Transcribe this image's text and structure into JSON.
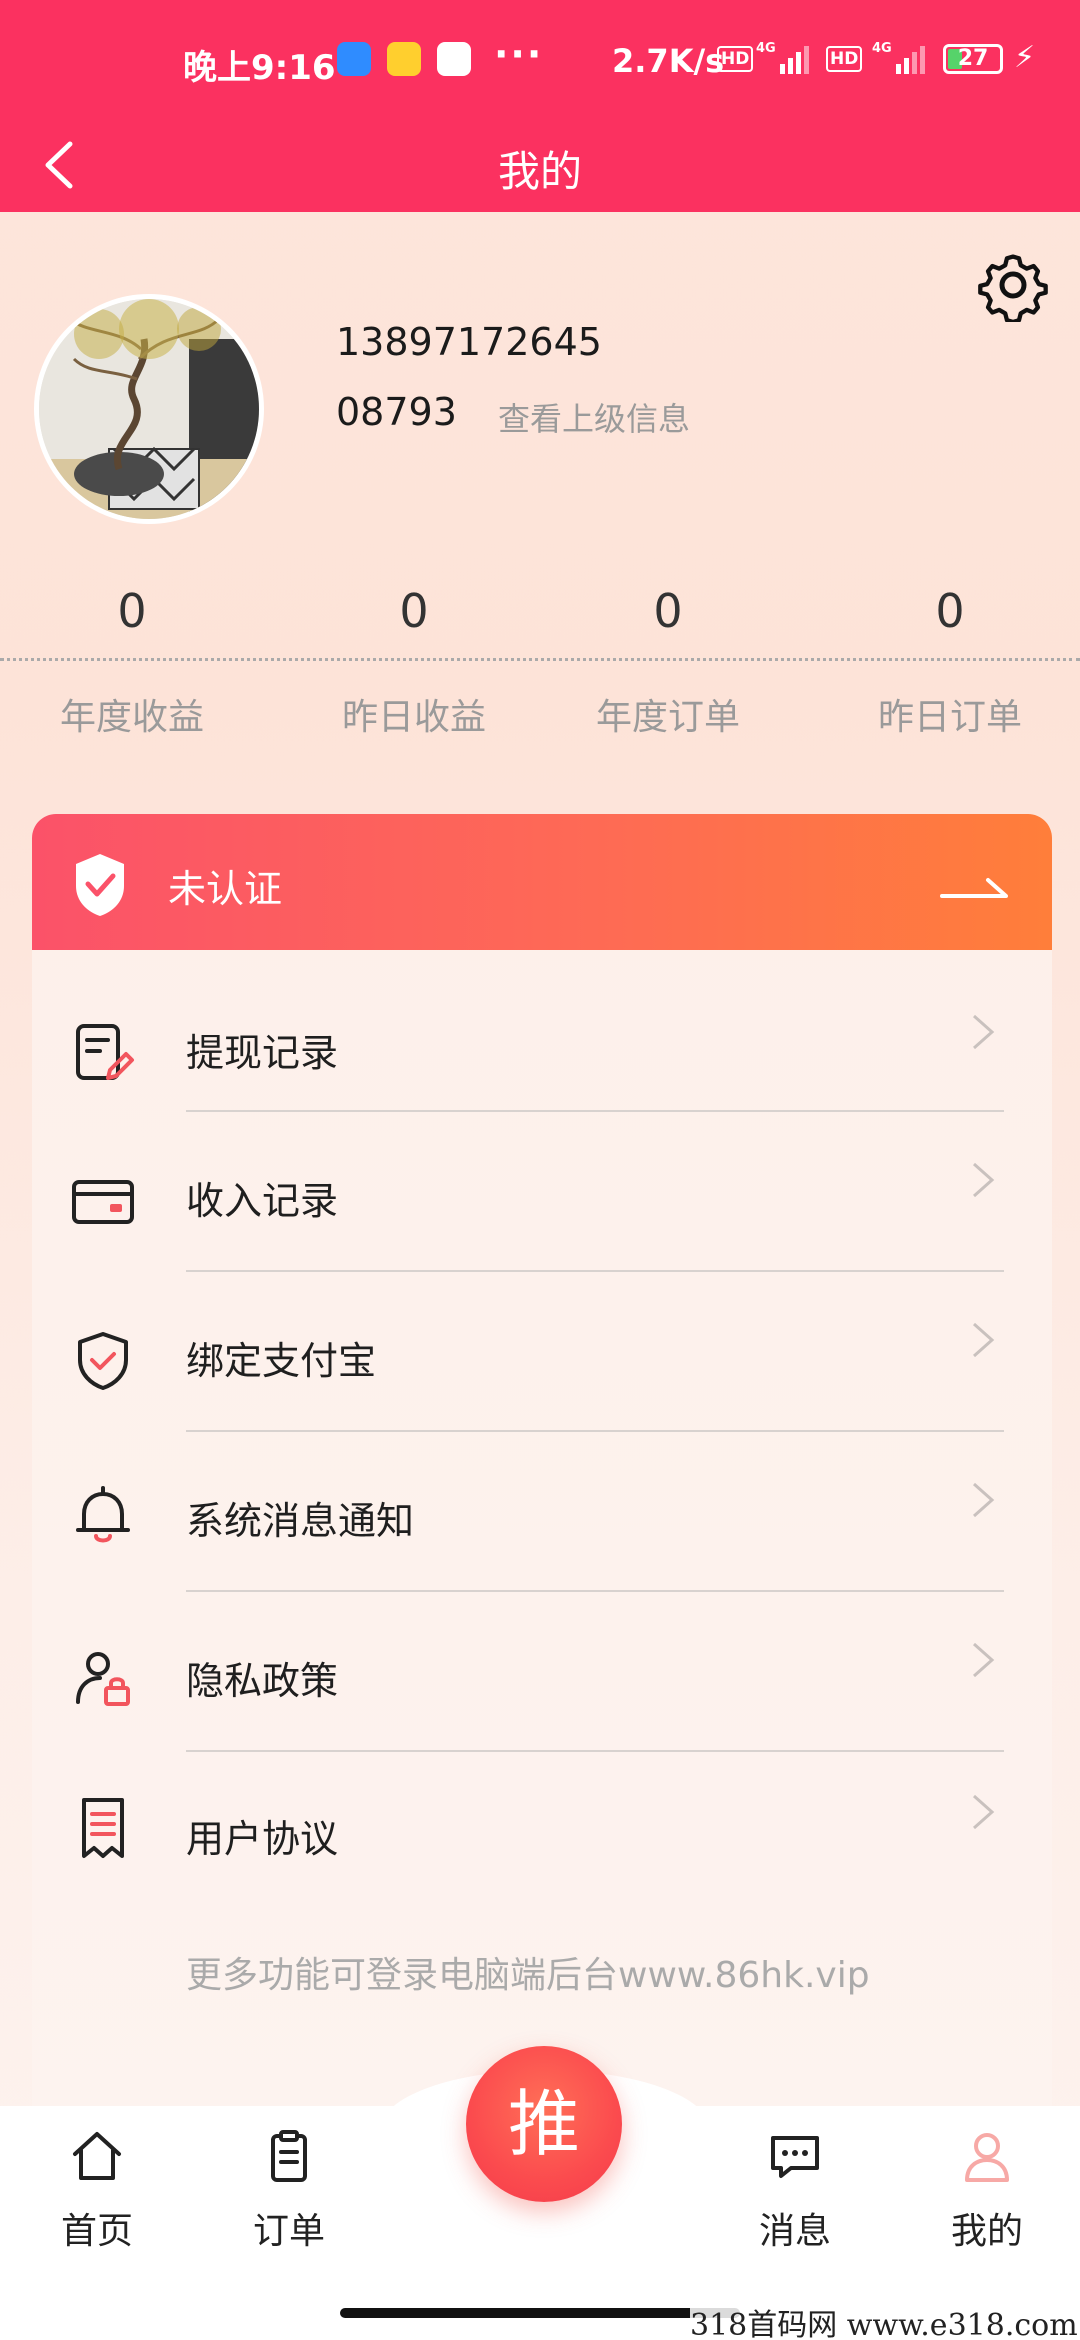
{
  "status_bar": {
    "time": "晚上9:16",
    "dots": "···",
    "speed": "2.7K/s",
    "hd1": "HD",
    "hd2": "HD",
    "net1": "4G",
    "net2": "4G",
    "battery": "27"
  },
  "header": {
    "title": "我的"
  },
  "profile": {
    "phone": "13897172645",
    "uid": "08793",
    "view_superior": "查看上级信息"
  },
  "stats": [
    {
      "value": "0",
      "label": "年度收益"
    },
    {
      "value": "0",
      "label": "昨日收益"
    },
    {
      "value": "0",
      "label": "年度订单"
    },
    {
      "value": "0",
      "label": "昨日订单"
    }
  ],
  "verify": {
    "label": "未认证"
  },
  "menu": [
    {
      "label": "提现记录",
      "icon": "withdraw-record-icon"
    },
    {
      "label": "收入记录",
      "icon": "income-card-icon"
    },
    {
      "label": "绑定支付宝",
      "icon": "shield-check-icon"
    },
    {
      "label": "系统消息通知",
      "icon": "bell-icon"
    },
    {
      "label": "隐私政策",
      "icon": "user-lock-icon"
    },
    {
      "label": "用户协议",
      "icon": "receipt-icon"
    }
  ],
  "footer_note": "更多功能可登录电脑端后台www.86hk.vip",
  "bottom_nav": {
    "home": "首页",
    "orders": "订单",
    "push": "推",
    "messages": "消息",
    "mine": "我的"
  },
  "watermark": "318首码网 www.e318.com",
  "colors": {
    "brand": "#fb3160",
    "verify_start": "#fb5269",
    "verify_end": "#ff7e3a",
    "accent_icon": "#f2555d",
    "active_tab_icon": "#f7a9a6"
  }
}
